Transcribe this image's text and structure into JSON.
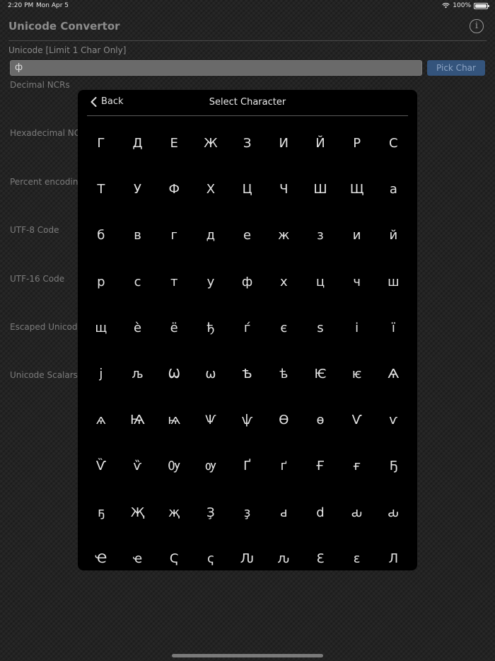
{
  "status_bar": {
    "time": "2:20 PM",
    "date": "Mon Apr 5",
    "battery": "100%"
  },
  "header": {
    "title": "Unicode Convertor",
    "info_icon": "info-icon"
  },
  "form": {
    "unicode_label": "Unicode [Limit 1 Char Only]",
    "input_value": "ф",
    "pick_button": "Pick Char"
  },
  "fields": [
    {
      "label": "Decimal NCRs"
    },
    {
      "label": "Hexadecimal NCR"
    },
    {
      "label": "Percent encoding"
    },
    {
      "label": "UTF-8 Code"
    },
    {
      "label": "UTF-16 Code"
    },
    {
      "label": "Escaped Unicode"
    },
    {
      "label": "Unicode Scalars"
    }
  ],
  "picker": {
    "back_label": "Back",
    "title": "Select Character",
    "characters": [
      "Г",
      "Д",
      "Е",
      "Ж",
      "З",
      "И",
      "Й",
      "Р",
      "С",
      "Т",
      "У",
      "Ф",
      "Х",
      "Ц",
      "Ч",
      "Ш",
      "Щ",
      "а",
      "б",
      "в",
      "г",
      "д",
      "е",
      "ж",
      "з",
      "и",
      "й",
      "р",
      "с",
      "т",
      "у",
      "ф",
      "х",
      "ц",
      "ч",
      "ш",
      "щ",
      "è",
      "ё",
      "ђ",
      "ѓ",
      "є",
      "ѕ",
      "і",
      "ї",
      "ј",
      "љ",
      "Ѡ",
      "ѡ",
      "Ѣ",
      "ѣ",
      "Ѥ",
      "ѥ",
      "Ѧ",
      "ѧ",
      "Ѩ",
      "ѩ",
      "Ѱ",
      "ѱ",
      "Ѳ",
      "ѳ",
      "Ѵ",
      "ѵ",
      "Ѷ",
      "ѷ",
      "Ѹ",
      "ѹ",
      "Ґ",
      "ґ",
      "Ғ",
      "ғ",
      "Ҕ",
      "ҕ",
      "Җ",
      "җ",
      "Ҙ",
      "ҙ",
      "ԁ",
      "d",
      "ԃ",
      "ԃ",
      "Ҽ",
      "ҽ",
      "Ҁ",
      "ҁ",
      "Ԉ",
      "ԉ",
      "Ɛ",
      "ε",
      "Л"
    ]
  }
}
